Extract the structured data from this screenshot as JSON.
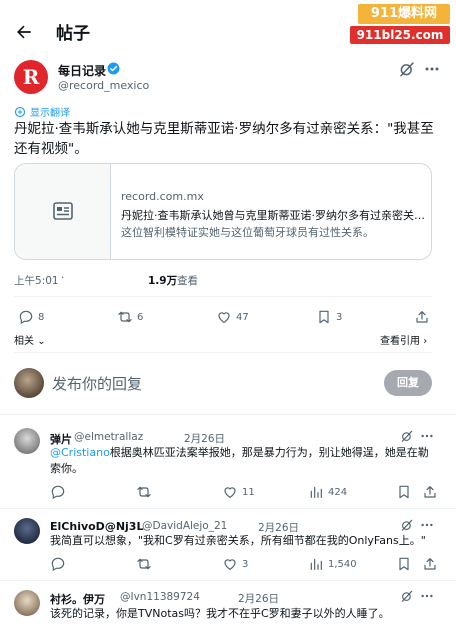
{
  "header": {
    "title": "帖子"
  },
  "watermark": {
    "line1": "911爆料网",
    "line2": "911bl25.com"
  },
  "post": {
    "author_name": "每日记录",
    "author_handle": "@record_mexico",
    "avatar_letter": "R",
    "translate_label": "显示翻译",
    "text": "丹妮拉·查韦斯承认她与克里斯蒂亚诺·罗纳尔多有过亲密关系：\"我甚至还有视频\"。",
    "card": {
      "domain": "record.com.mx",
      "title": "丹妮拉·查韦斯承认她曾与克里斯蒂亚诺·罗纳尔多有过亲密关系...",
      "description": "这位智利模特证实她与这位葡萄牙球员有过性关系。"
    },
    "time": "上午5:01",
    "views_count": "1.9万",
    "views_label": "查看",
    "stats": {
      "replies": "8",
      "retweets": "6",
      "likes": "47",
      "bookmarks": "3"
    },
    "related_label": "相关",
    "quotes_label": "查看引用"
  },
  "reply_box": {
    "placeholder": "发布你的回复",
    "button_label": "回复"
  },
  "replies": [
    {
      "name": "弹片",
      "handle": "@elmetrallaz",
      "date": "2月26日",
      "mention": "@Cristiano",
      "text": "根据奥林匹亚法案举报她，那是暴力行为，别让她得逞，她是在勒索你。",
      "stats": {
        "replies": "",
        "retweets": "",
        "likes": "11",
        "views": "424"
      }
    },
    {
      "name": "ElChivoD@Nj3L",
      "handle": "@DavidAlejo_21",
      "date": "2月26日",
      "text": "我简直可以想象，\"我和C罗有过亲密关系，所有细节都在我的OnlyFans上。\"",
      "stats": {
        "replies": "",
        "retweets": "",
        "likes": "3",
        "views": "1,540"
      }
    },
    {
      "name": "衬衫。伊万",
      "handle": "@Ivn11389724",
      "date": "2月26日",
      "text": "该死的记录，你是TVNotas吗？我才不在乎C罗和妻子以外的人睡了。"
    }
  ],
  "colors": {
    "accent": "#1d9bf0",
    "text": "#0f1419",
    "muted": "#536471",
    "avatar_red": "#e0262b"
  }
}
